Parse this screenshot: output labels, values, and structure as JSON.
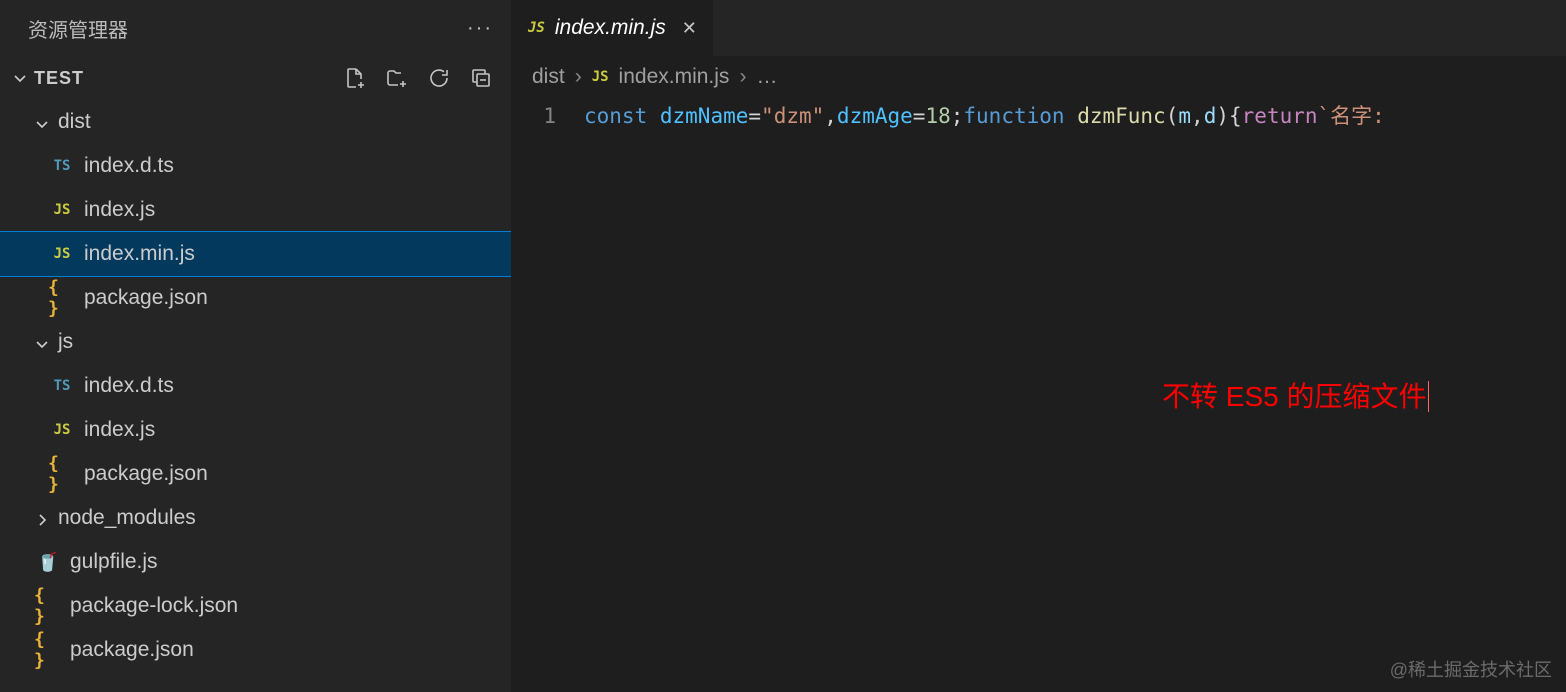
{
  "sidebar": {
    "title": "资源管理器",
    "root": "TEST",
    "tree": [
      {
        "type": "folder",
        "name": "dist",
        "expanded": true,
        "depth": 1
      },
      {
        "type": "file",
        "name": "index.d.ts",
        "icon": "ts",
        "depth": 2
      },
      {
        "type": "file",
        "name": "index.js",
        "icon": "js",
        "depth": 2
      },
      {
        "type": "file",
        "name": "index.min.js",
        "icon": "js",
        "depth": 2,
        "selected": true
      },
      {
        "type": "file",
        "name": "package.json",
        "icon": "json",
        "depth": 2
      },
      {
        "type": "folder",
        "name": "js",
        "expanded": true,
        "depth": 1
      },
      {
        "type": "file",
        "name": "index.d.ts",
        "icon": "ts",
        "depth": 2
      },
      {
        "type": "file",
        "name": "index.js",
        "icon": "js",
        "depth": 2
      },
      {
        "type": "file",
        "name": "package.json",
        "icon": "json",
        "depth": 2
      },
      {
        "type": "folder",
        "name": "node_modules",
        "expanded": false,
        "depth": 1
      },
      {
        "type": "file",
        "name": "gulpfile.js",
        "icon": "gulp",
        "depth": 1
      },
      {
        "type": "file",
        "name": "package-lock.json",
        "icon": "json",
        "depth": 1
      },
      {
        "type": "file",
        "name": "package.json",
        "icon": "json",
        "depth": 1
      }
    ]
  },
  "tab": {
    "icon": "js",
    "label": "index.min.js"
  },
  "breadcrumb": {
    "seg0": "dist",
    "icon": "js",
    "seg1": "index.min.js",
    "tail": "…"
  },
  "code": {
    "lineNumber": "1",
    "tokens": {
      "kw_const": "const",
      "var1": "dzmName",
      "eq1": "=",
      "str1": "\"dzm\"",
      "comma1": ",",
      "var2": "dzmAge",
      "eq2": "=",
      "num1": "18",
      "semi1": ";",
      "kw_func": "function",
      "fn1": "dzmFunc",
      "popen": "(",
      "p1": "m",
      "pcomma": ",",
      "p2": "d",
      "pclose": ")",
      "bopen": "{",
      "kw_ret": "return",
      "tstr": "`名字:"
    }
  },
  "annotation": "不转 ES5 的压缩文件",
  "watermark": "@稀土掘金技术社区"
}
